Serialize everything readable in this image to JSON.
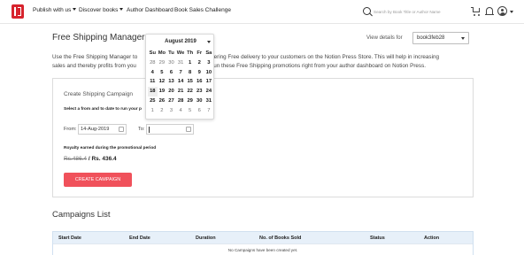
{
  "nav": {
    "items": [
      {
        "label": "Publish with us",
        "dropdown": true
      },
      {
        "label": "Discover books",
        "dropdown": true
      },
      {
        "label": "Author Dashboard",
        "dropdown": false
      },
      {
        "label": "Book Sales Challenge",
        "dropdown": false
      }
    ],
    "search_placeholder": "Search by Book Title or Author Name",
    "icons": [
      "search-icon",
      "cart-icon",
      "bell-icon",
      "user-icon"
    ]
  },
  "header": {
    "title": "Free Shipping Manager",
    "view_details_label": "View details for",
    "book_select_value": "book3feb28"
  },
  "intro": {
    "before": "Use the Free Shipping Manager to",
    "middle": "ffering Free delivery to your customers on the Notion Press Store. This will help in increasing",
    "line2_start": "sales and thereby profits from you",
    "line2_end": "d run these Free Shipping promotions right from your author dashboard on Notion Press."
  },
  "campaign_form": {
    "title": "Create Shipping Campaign",
    "subtitle": "Select a from and to date to run your p",
    "from_label": "From:",
    "from_value": "14-Aug-2019",
    "to_label": "To:",
    "royalty_label": "Royalty earned during the promotional period",
    "old_price": "Rs.486.4",
    "separator": "/",
    "new_price": "Rs. 436.4",
    "button_label": "CREATE CAMPAIGN"
  },
  "datepicker": {
    "month_label": "August 2019",
    "weekdays": [
      "Su",
      "Mo",
      "Tu",
      "We",
      "Th",
      "Fr",
      "Sa"
    ],
    "weeks": [
      [
        "28",
        "29",
        "30",
        "31",
        "1",
        "2",
        "3"
      ],
      [
        "4",
        "5",
        "6",
        "7",
        "8",
        "9",
        "10"
      ],
      [
        "11",
        "12",
        "13",
        "14",
        "15",
        "16",
        "17"
      ],
      [
        "18",
        "19",
        "20",
        "21",
        "22",
        "23",
        "24"
      ],
      [
        "25",
        "26",
        "27",
        "28",
        "29",
        "30",
        "31"
      ],
      [
        "1",
        "2",
        "3",
        "4",
        "5",
        "6",
        "7"
      ]
    ],
    "highlighted": "18"
  },
  "campaigns": {
    "title": "Campaigns List",
    "columns": [
      "Start Date",
      "End Date",
      "Duration",
      "No. of Books Sold",
      "Status",
      "Action"
    ],
    "empty_message": "No Campaigns have been created yet."
  },
  "colors": {
    "brand": "#d7232d",
    "cta": "#f0515b",
    "table_header": "#e7f0f9"
  }
}
